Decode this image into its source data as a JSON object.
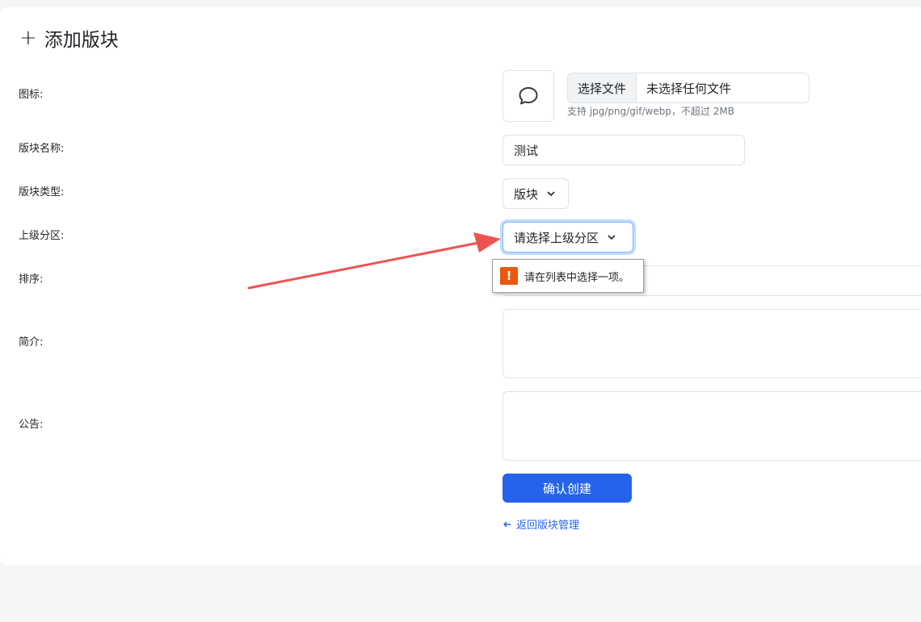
{
  "page": {
    "title": "添加版块",
    "plus_icon": "plus-icon"
  },
  "form": {
    "icon_label": "图标:",
    "icon_preview": "chat-bubble-icon",
    "file_button": "选择文件",
    "file_name": "未选择任何文件",
    "file_hint": "支持 jpg/png/gif/webp，不超过 2MB",
    "name_label": "版块名称:",
    "name_value": "测试",
    "type_label": "版块类型:",
    "type_value": "版块",
    "parent_label": "上级分区:",
    "parent_value": "请选择上级分区",
    "order_label": "排序:",
    "intro_label": "简介:",
    "notice_label": "公告:",
    "submit_label": "确认创建",
    "back_label": "返回版块管理"
  },
  "validation": {
    "message": "请在列表中选择一项。",
    "icon": "warning-icon"
  },
  "colors": {
    "primary": "#2563eb",
    "warning": "#e8590c",
    "annotation_arrow": "#ef5350"
  }
}
